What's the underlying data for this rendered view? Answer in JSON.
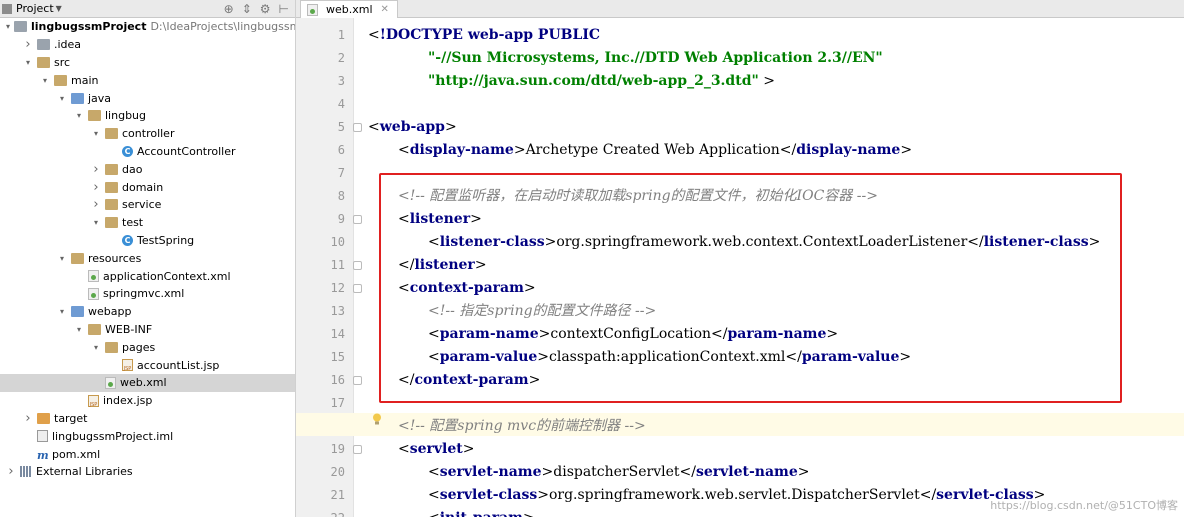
{
  "project_panel": {
    "title": "Project",
    "tree": [
      {
        "label": "lingbugssmProject",
        "hint": "D:\\IdeaProjects\\lingbugssmProject",
        "depth": 0,
        "arrow": "down",
        "icon": "folder-gray",
        "bold": true
      },
      {
        "label": ".idea",
        "depth": 1,
        "arrow": "right",
        "icon": "folder-gray"
      },
      {
        "label": "src",
        "depth": 1,
        "arrow": "down",
        "icon": "folder"
      },
      {
        "label": "main",
        "depth": 2,
        "arrow": "down",
        "icon": "folder"
      },
      {
        "label": "java",
        "depth": 3,
        "arrow": "down",
        "icon": "folder-blue"
      },
      {
        "label": "lingbug",
        "depth": 4,
        "arrow": "down",
        "icon": "folder"
      },
      {
        "label": "controller",
        "depth": 5,
        "arrow": "down",
        "icon": "folder"
      },
      {
        "label": "AccountController",
        "depth": 6,
        "arrow": "",
        "icon": "class"
      },
      {
        "label": "dao",
        "depth": 5,
        "arrow": "right",
        "icon": "folder"
      },
      {
        "label": "domain",
        "depth": 5,
        "arrow": "right",
        "icon": "folder"
      },
      {
        "label": "service",
        "depth": 5,
        "arrow": "right",
        "icon": "folder"
      },
      {
        "label": "test",
        "depth": 5,
        "arrow": "down",
        "icon": "folder"
      },
      {
        "label": "TestSpring",
        "depth": 6,
        "arrow": "",
        "icon": "class"
      },
      {
        "label": "resources",
        "depth": 3,
        "arrow": "down",
        "icon": "folder"
      },
      {
        "label": "applicationContext.xml",
        "depth": 4,
        "arrow": "",
        "icon": "xml"
      },
      {
        "label": "springmvc.xml",
        "depth": 4,
        "arrow": "",
        "icon": "xml"
      },
      {
        "label": "webapp",
        "depth": 3,
        "arrow": "down",
        "icon": "folder-blue"
      },
      {
        "label": "WEB-INF",
        "depth": 4,
        "arrow": "down",
        "icon": "folder"
      },
      {
        "label": "pages",
        "depth": 5,
        "arrow": "down",
        "icon": "folder"
      },
      {
        "label": "accountList.jsp",
        "depth": 6,
        "arrow": "",
        "icon": "jsp"
      },
      {
        "label": "web.xml",
        "depth": 5,
        "arrow": "",
        "icon": "xml",
        "selected": true
      },
      {
        "label": "index.jsp",
        "depth": 4,
        "arrow": "",
        "icon": "jsp"
      },
      {
        "label": "target",
        "depth": 1,
        "arrow": "right",
        "icon": "folder-orange"
      },
      {
        "label": "lingbugssmProject.iml",
        "depth": 1,
        "arrow": "",
        "icon": "iml"
      },
      {
        "label": "pom.xml",
        "depth": 1,
        "arrow": "",
        "icon": "m"
      },
      {
        "label": "External Libraries",
        "depth": 0,
        "arrow": "right",
        "icon": "lib"
      }
    ]
  },
  "editor": {
    "tab_label": "web.xml",
    "lines": [
      {
        "n": "1",
        "parts": [
          [
            "punct",
            "<"
          ],
          [
            "tagname",
            "!DOCTYPE "
          ],
          [
            "tagname",
            "web-app"
          ],
          [
            "tagname",
            " PUBLIC"
          ]
        ],
        "indent": 0
      },
      {
        "n": "2",
        "parts": [
          [
            "str",
            "\"-//Sun Microsystems, Inc.//DTD Web Application 2.3//EN\""
          ]
        ],
        "indent": 4
      },
      {
        "n": "3",
        "parts": [
          [
            "str",
            "\"http://java.sun.com/dtd/web-app_2_3.dtd\""
          ],
          [
            "punct",
            " >"
          ]
        ],
        "indent": 4
      },
      {
        "n": "4",
        "parts": [],
        "indent": 0
      },
      {
        "n": "5",
        "parts": [
          [
            "punct",
            "<"
          ],
          [
            "tagname",
            "web-app"
          ],
          [
            "punct",
            ">"
          ]
        ],
        "indent": 0
      },
      {
        "n": "6",
        "parts": [
          [
            "punct",
            "<"
          ],
          [
            "tagname",
            "display-name"
          ],
          [
            "punct",
            ">"
          ],
          [
            "txt",
            "Archetype Created Web Application"
          ],
          [
            "punct",
            "</"
          ],
          [
            "tagname",
            "display-name"
          ],
          [
            "punct",
            ">"
          ]
        ],
        "indent": 2
      },
      {
        "n": "7",
        "parts": [],
        "indent": 0
      },
      {
        "n": "8",
        "parts": [
          [
            "cmt",
            "<!-- 配置监听器，在启动时读取加载spring的配置文件，初始化IOC容器 -->"
          ]
        ],
        "indent": 2
      },
      {
        "n": "9",
        "parts": [
          [
            "punct",
            "<"
          ],
          [
            "tagname",
            "listener"
          ],
          [
            "punct",
            ">"
          ]
        ],
        "indent": 2
      },
      {
        "n": "10",
        "parts": [
          [
            "punct",
            "<"
          ],
          [
            "tagname",
            "listener-class"
          ],
          [
            "punct",
            ">"
          ],
          [
            "txt",
            "org.springframework.web.context.ContextLoaderListener"
          ],
          [
            "punct",
            "</"
          ],
          [
            "tagname",
            "listener-class"
          ],
          [
            "punct",
            ">"
          ]
        ],
        "indent": 4
      },
      {
        "n": "11",
        "parts": [
          [
            "punct",
            "</"
          ],
          [
            "tagname",
            "listener"
          ],
          [
            "punct",
            ">"
          ]
        ],
        "indent": 2
      },
      {
        "n": "12",
        "parts": [
          [
            "punct",
            "<"
          ],
          [
            "tagname",
            "context-param"
          ],
          [
            "punct",
            ">"
          ]
        ],
        "indent": 2
      },
      {
        "n": "13",
        "parts": [
          [
            "cmt",
            "<!-- 指定spring的配置文件路径 -->"
          ]
        ],
        "indent": 4
      },
      {
        "n": "14",
        "parts": [
          [
            "punct",
            "<"
          ],
          [
            "tagname",
            "param-name"
          ],
          [
            "punct",
            ">"
          ],
          [
            "txt",
            "contextConfigLocation"
          ],
          [
            "punct",
            "</"
          ],
          [
            "tagname",
            "param-name"
          ],
          [
            "punct",
            ">"
          ]
        ],
        "indent": 4
      },
      {
        "n": "15",
        "parts": [
          [
            "punct",
            "<"
          ],
          [
            "tagname",
            "param-value"
          ],
          [
            "punct",
            ">"
          ],
          [
            "txt",
            "classpath:applicationContext.xml"
          ],
          [
            "punct",
            "</"
          ],
          [
            "tagname",
            "param-value"
          ],
          [
            "punct",
            ">"
          ]
        ],
        "indent": 4
      },
      {
        "n": "16",
        "parts": [
          [
            "punct",
            "</"
          ],
          [
            "tagname",
            "context-param"
          ],
          [
            "punct",
            ">"
          ]
        ],
        "indent": 2
      },
      {
        "n": "17",
        "parts": [],
        "indent": 0
      },
      {
        "n": "18",
        "parts": [
          [
            "cmt",
            "<!-- 配置spring mvc的前端控制器 -->"
          ]
        ],
        "indent": 2
      },
      {
        "n": "19",
        "parts": [
          [
            "punct",
            "<"
          ],
          [
            "tagname",
            "servlet"
          ],
          [
            "punct",
            ">"
          ]
        ],
        "indent": 2
      },
      {
        "n": "20",
        "parts": [
          [
            "punct",
            "<"
          ],
          [
            "tagname",
            "servlet-name"
          ],
          [
            "punct",
            ">"
          ],
          [
            "txt",
            "dispatcherServlet"
          ],
          [
            "punct",
            "</"
          ],
          [
            "tagname",
            "servlet-name"
          ],
          [
            "punct",
            ">"
          ]
        ],
        "indent": 4
      },
      {
        "n": "21",
        "parts": [
          [
            "punct",
            "<"
          ],
          [
            "tagname",
            "servlet-class"
          ],
          [
            "punct",
            ">"
          ],
          [
            "txt",
            "org.springframework.web.servlet.DispatcherServlet"
          ],
          [
            "punct",
            "</"
          ],
          [
            "tagname",
            "servlet-class"
          ],
          [
            "punct",
            ">"
          ]
        ],
        "indent": 4
      },
      {
        "n": "22",
        "parts": [
          [
            "punct",
            "<"
          ],
          [
            "tagname",
            "init-param"
          ],
          [
            "punct",
            ">"
          ]
        ],
        "indent": 4
      }
    ],
    "watermark": "https://blog.csdn.net/@51CTO博客"
  }
}
